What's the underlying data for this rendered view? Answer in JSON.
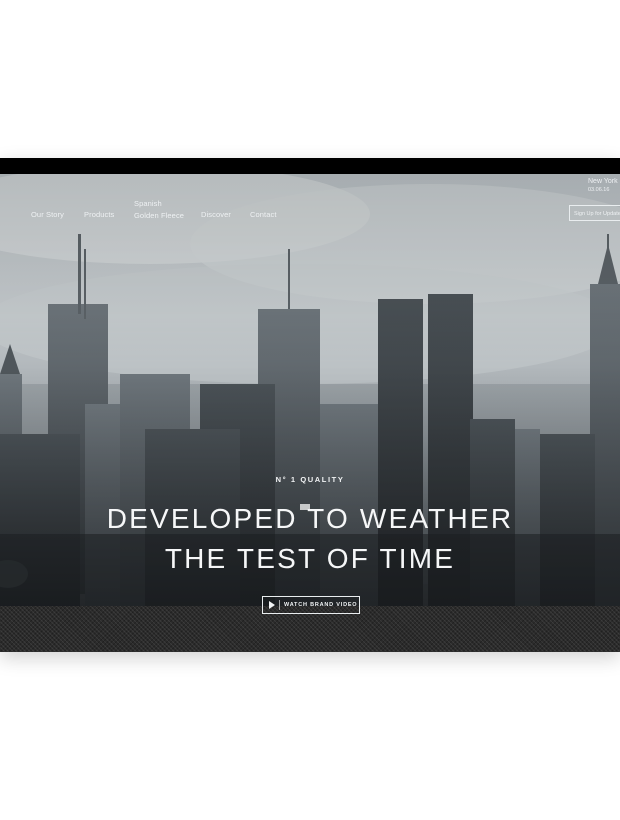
{
  "nav": {
    "items": [
      {
        "label": "Our Story"
      },
      {
        "label": "Products"
      },
      {
        "label_line1": "Spanish",
        "label_line2": "Golden Fleece"
      },
      {
        "label": "Discover"
      },
      {
        "label": "Contact"
      }
    ]
  },
  "location": {
    "city": "New York",
    "date": "03.06.16"
  },
  "signup": {
    "label": "Sign Up for Updates"
  },
  "hero": {
    "kicker": "N° 1 QUALITY",
    "headline_line1": "DEVELOPED TO WEATHER",
    "headline_line2": "THE TEST OF TIME",
    "video_button": "WATCH BRAND VIDEO"
  },
  "icons": {
    "play": "play-icon"
  },
  "colors": {
    "text": "#f2f4f5",
    "frame": "#000000",
    "page": "#ffffff"
  }
}
